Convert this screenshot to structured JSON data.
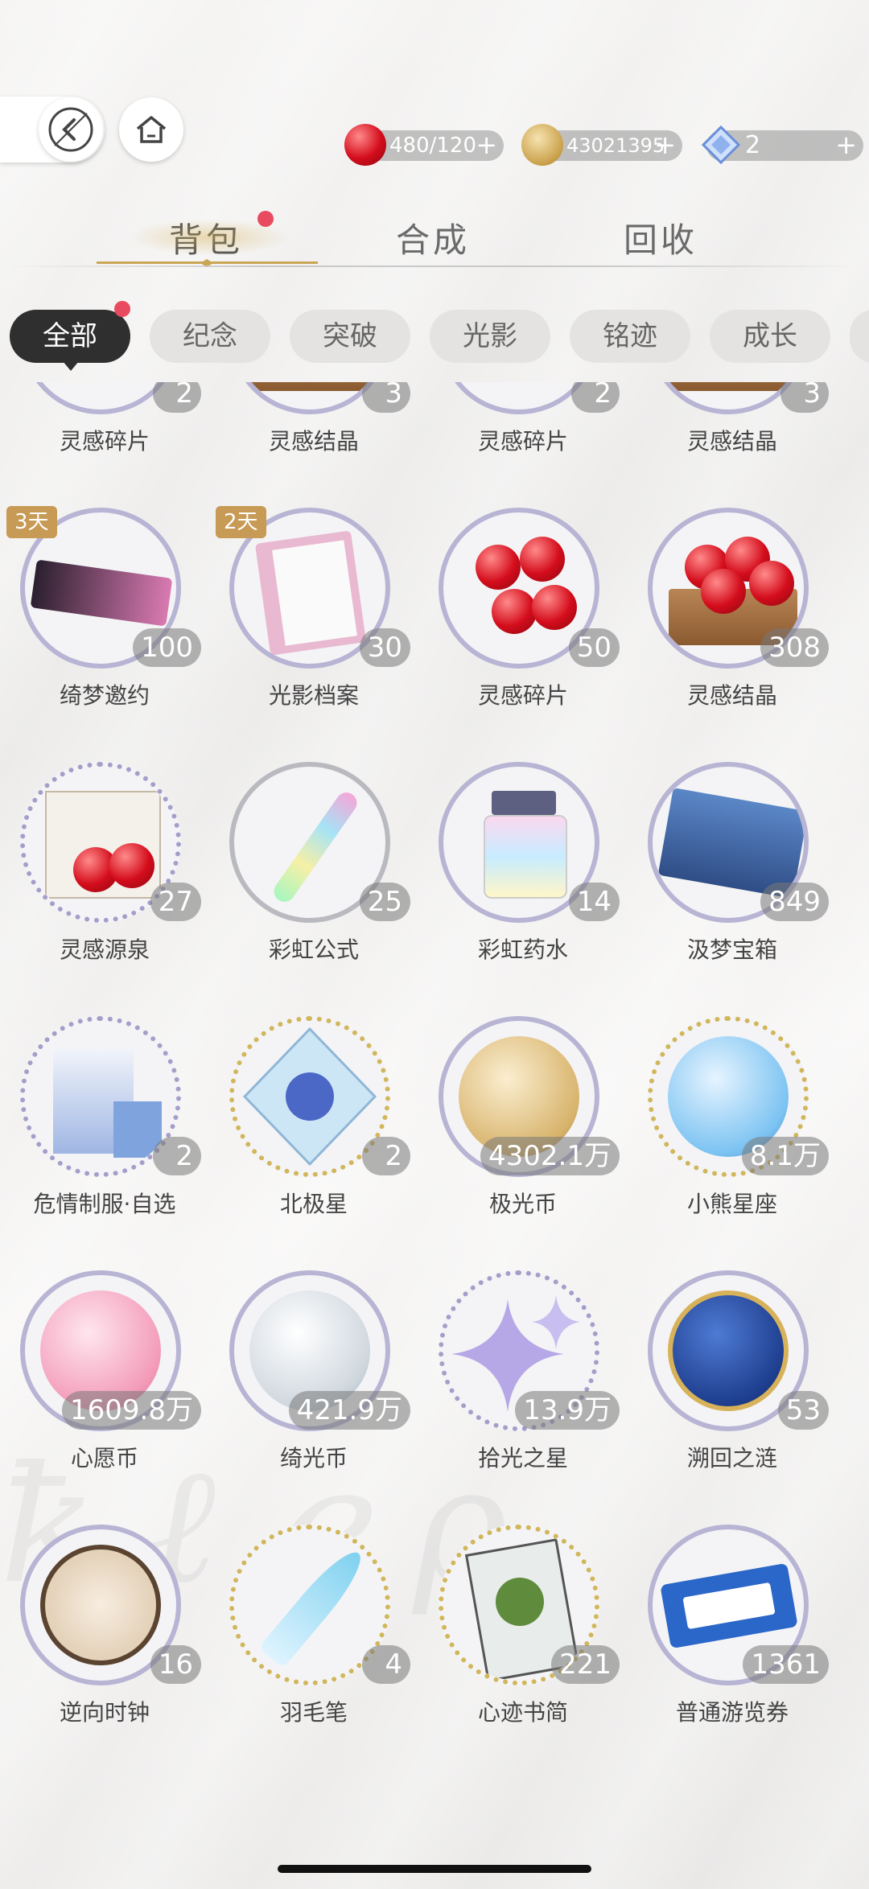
{
  "header": {
    "resources": [
      {
        "icon": "apple-icon",
        "value": "480/120",
        "color": "#d40d1c"
      },
      {
        "icon": "gold-coin-icon",
        "value": "43021395",
        "color": "#c9a04a"
      },
      {
        "icon": "diamond-icon",
        "value": "2",
        "color": "#6a8fd8"
      }
    ]
  },
  "tabs": [
    {
      "label": "背包",
      "active": true
    },
    {
      "label": "合成",
      "active": false
    },
    {
      "label": "回收",
      "active": false
    }
  ],
  "filters": [
    "全部",
    "纪念",
    "突破",
    "光影",
    "铭迹",
    "成长"
  ],
  "items": [
    {
      "name": "灵感碎片",
      "qty": "2",
      "icon": "apples-icon",
      "ring": "blue"
    },
    {
      "name": "灵感结晶",
      "qty": "3",
      "icon": "apple-crate-icon",
      "ring": "blue"
    },
    {
      "name": "灵感碎片",
      "qty": "2",
      "icon": "apples-icon",
      "ring": "blue"
    },
    {
      "name": "灵感结晶",
      "qty": "3",
      "icon": "apple-crate-icon",
      "ring": "blue"
    },
    {
      "name": "绮梦邀约",
      "qty": "100",
      "icon": "invitation-ticket-icon",
      "ring": "blue",
      "timer": "3天"
    },
    {
      "name": "光影档案",
      "qty": "30",
      "icon": "design-folder-icon",
      "ring": "blue",
      "timer": "2天"
    },
    {
      "name": "灵感碎片",
      "qty": "50",
      "icon": "apples-icon",
      "ring": "blue"
    },
    {
      "name": "灵感结晶",
      "qty": "308",
      "icon": "apple-crate-icon",
      "ring": "blue"
    },
    {
      "name": "灵感源泉",
      "qty": "27",
      "icon": "apple-box-icon",
      "ring": "sparkle"
    },
    {
      "name": "彩虹公式",
      "qty": "25",
      "icon": "rainbow-tube-icon",
      "ring": "silver"
    },
    {
      "name": "彩虹药水",
      "qty": "14",
      "icon": "rainbow-potion-icon",
      "ring": "blue"
    },
    {
      "name": "汲梦宝箱",
      "qty": "849",
      "icon": "dream-chest-icon",
      "ring": "blue"
    },
    {
      "name": "危情制服·自选",
      "qty": "2",
      "icon": "gift-bag-icon",
      "ring": "sparkle"
    },
    {
      "name": "北极星",
      "qty": "2",
      "icon": "polaris-crystal-icon",
      "ring": "gold"
    },
    {
      "name": "极光币",
      "qty": "4302.1万",
      "icon": "aurora-coin-icon",
      "ring": "blue"
    },
    {
      "name": "小熊星座",
      "qty": "8.1万",
      "icon": "ursa-coin-icon",
      "ring": "gold"
    },
    {
      "name": "心愿币",
      "qty": "1609.8万",
      "icon": "wish-coin-icon",
      "ring": "blue"
    },
    {
      "name": "绮光币",
      "qty": "421.9万",
      "icon": "silver-coin-icon",
      "ring": "blue"
    },
    {
      "name": "拾光之星",
      "qty": "13.9万",
      "icon": "sparkle-star-icon",
      "ring": "sparkle"
    },
    {
      "name": "溯回之涟",
      "qty": "53",
      "icon": "sun-moon-coin-icon",
      "ring": "blue"
    },
    {
      "name": "逆向时钟",
      "qty": "16",
      "icon": "reverse-clock-icon",
      "ring": "blue"
    },
    {
      "name": "羽毛笔",
      "qty": "4",
      "icon": "quill-pen-icon",
      "ring": "gold"
    },
    {
      "name": "心迹书简",
      "qty": "221",
      "icon": "herb-letter-icon",
      "ring": "gold"
    },
    {
      "name": "普通游览券",
      "qty": "1361",
      "icon": "tour-ticket-icon",
      "ring": "blue"
    }
  ]
}
